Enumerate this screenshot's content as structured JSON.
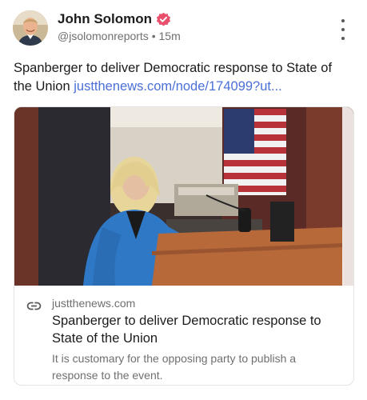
{
  "author": {
    "name": "John Solomon",
    "handle": "@jsolomonreports",
    "separator": "•",
    "time": "15m",
    "verified": true
  },
  "post": {
    "text": "Spanberger to deliver Democratic response to State of the Union",
    "link_text": "justthenews.com/node/174099?ut..."
  },
  "card": {
    "domain": "justthenews.com",
    "title": "Spanberger to deliver Democratic response to State of the Union",
    "description": "It is customary for the opposing party to publish a response to the event."
  },
  "colors": {
    "link": "#4b6fd6",
    "verified_badge": "#e8506e",
    "secondary_text": "#6f6f6f"
  },
  "icons": [
    "verified-badge-icon",
    "more-options-icon",
    "link-icon"
  ]
}
